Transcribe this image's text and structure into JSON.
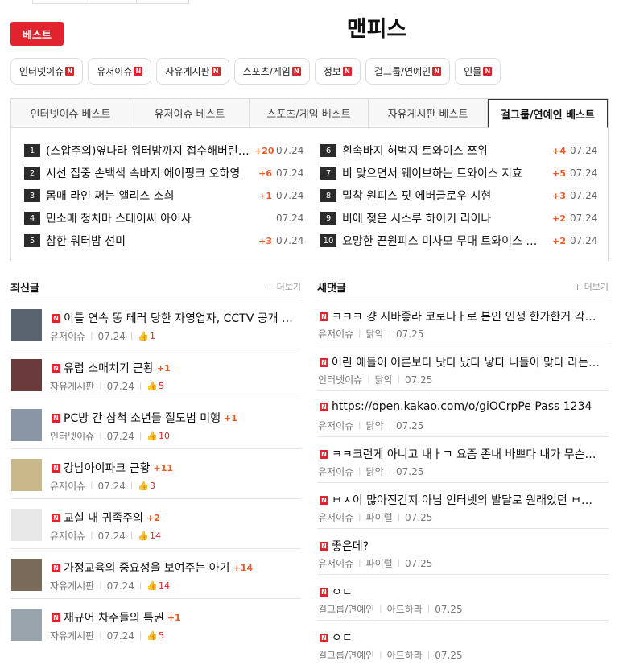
{
  "header": {
    "best_button": "베스트",
    "site_title": "맨피스"
  },
  "categories": [
    {
      "label": "인터넷이슈",
      "badge": "N"
    },
    {
      "label": "유저이슈",
      "badge": "N"
    },
    {
      "label": "자유게시판",
      "badge": "N"
    },
    {
      "label": "스포츠/게임",
      "badge": "N"
    },
    {
      "label": "정보",
      "badge": "N"
    },
    {
      "label": "걸그룹/연예인",
      "badge": "N"
    },
    {
      "label": "인물",
      "badge": "N"
    }
  ],
  "best": {
    "tabs": [
      "인터넷이슈 베스트",
      "유저이슈 베스트",
      "스포츠/게임 베스트",
      "자유게시판 베스트",
      "걸그룹/연예인 베스트"
    ],
    "active_tab": 4,
    "left": [
      {
        "rank": "1",
        "title": "(스압주의)옆나라 워터밤까지 접수해버린 …",
        "count": "+20",
        "date": "07.24"
      },
      {
        "rank": "2",
        "title": "시선 집중 손백색 속바지 에이핑크 오하영",
        "count": "+6",
        "date": "07.24"
      },
      {
        "rank": "3",
        "title": "몸매 라인 쩌는 앨리스 소희",
        "count": "+1",
        "date": "07.24"
      },
      {
        "rank": "4",
        "title": "민소매 청치마 스테이씨 아이사",
        "count": "",
        "date": "07.24"
      },
      {
        "rank": "5",
        "title": "참한 워터밤 선미",
        "count": "+3",
        "date": "07.24"
      }
    ],
    "right": [
      {
        "rank": "6",
        "title": "흰속바지 허벅지 트와이스 쯔위",
        "count": "+4",
        "date": "07.24"
      },
      {
        "rank": "7",
        "title": "비 맞으면서 웨이브하는 트와이스 지효",
        "count": "+5",
        "date": "07.24"
      },
      {
        "rank": "8",
        "title": "밀착 원피스 핏 에버글로우 시현",
        "count": "+3",
        "date": "07.24"
      },
      {
        "rank": "9",
        "title": "비에 젖은 시스루 하이키 리이나",
        "count": "+2",
        "date": "07.24"
      },
      {
        "rank": "10",
        "title": "요망한 끈원피스 미사모 무대 트와이스 …",
        "count": "+2",
        "date": "07.24"
      }
    ]
  },
  "latest": {
    "title": "최신글",
    "more": "+ 더보기",
    "posts": [
      {
        "title": "이틀 연속 똥 테러 당한 자영업자, CCTV 공개 …",
        "count": "",
        "board": "유저이슈",
        "date": "07.24",
        "likes": "1",
        "thumb_color": "#5a6470"
      },
      {
        "title": "유럽 소매치기 근황",
        "count": "+1",
        "board": "자유게시판",
        "date": "07.24",
        "likes": "5",
        "thumb_color": "#6b3a3a"
      },
      {
        "title": "PC방 간 삼척 소년들 절도범 미행",
        "count": "+1",
        "board": "인터넷이슈",
        "date": "07.24",
        "likes": "10",
        "thumb_color": "#8a96a6"
      },
      {
        "title": "강남아이파크 근황",
        "count": "+11",
        "board": "유저이슈",
        "date": "07.24",
        "likes": "3",
        "thumb_color": "#c9b98a"
      },
      {
        "title": "교실 내 귀족주의",
        "count": "+2",
        "board": "유저이슈",
        "date": "07.24",
        "likes": "14",
        "thumb_color": "#e8e8e8"
      },
      {
        "title": "가정교육의 중요성을 보여주는 아기",
        "count": "+14",
        "board": "자유게시판",
        "date": "07.24",
        "likes": "14",
        "thumb_color": "#7a6a5a"
      },
      {
        "title": "재규어 차주들의 특권",
        "count": "+1",
        "board": "자유게시판",
        "date": "07.24",
        "likes": "5",
        "thumb_color": "#9aa4ac"
      }
    ]
  },
  "comments": {
    "title": "새댓글",
    "more": "+ 더보기",
    "items": [
      {
        "text": "ㅋㅋㅋ 걍 시바좋라 코로나ㅏ로 본인 인생 한가한거 각…",
        "board": "유저이슈",
        "author": "닭악",
        "date": "07.25"
      },
      {
        "text": "어린 애들이 어른보다 낫다 났다 낳다 니들이 맞다 라는…",
        "board": "인터넷이슈",
        "author": "닭악",
        "date": "07.25"
      },
      {
        "text": "https://open.kakao.com/o/giOCrpPe Pass 1234",
        "board": "유저이슈",
        "author": "닭악",
        "date": "07.25"
      },
      {
        "text": "ㅋㅋ크런게 아니고 내ㅏㄱ 요즘 존내 바쁘다 내가 무슨…",
        "board": "유저이슈",
        "author": "닭악",
        "date": "07.25"
      },
      {
        "text": "ㅂㅅ이 많아진건지 아님 인터넷의 발달로 원래있던 ㅂ…",
        "board": "유저이슈",
        "author": "파이럴",
        "date": "07.25"
      },
      {
        "text": "좋은데?",
        "board": "유저이슈",
        "author": "파이럴",
        "date": "07.25"
      },
      {
        "text": "ㅇㄷ",
        "board": "걸그룹/연예인",
        "author": "아드하라",
        "date": "07.25"
      },
      {
        "text": "ㅇㄷ",
        "board": "걸그룹/연예인",
        "author": "아드하라",
        "date": "07.25"
      }
    ]
  }
}
